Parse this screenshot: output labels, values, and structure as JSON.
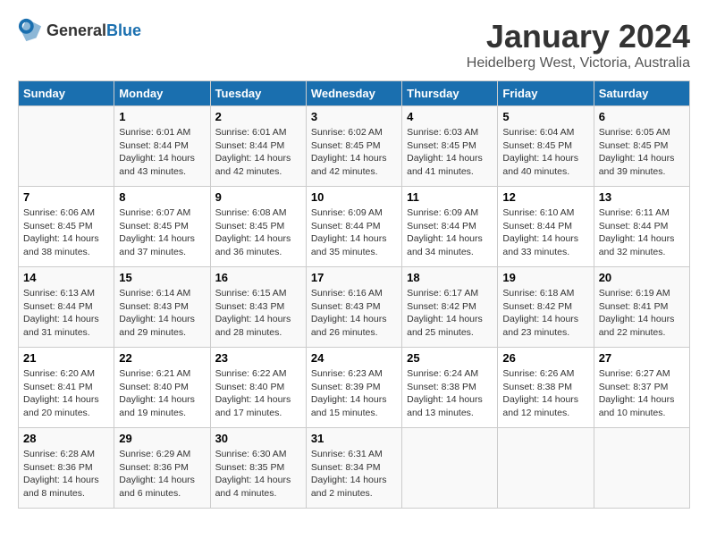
{
  "header": {
    "logo_general": "General",
    "logo_blue": "Blue",
    "month": "January 2024",
    "location": "Heidelberg West, Victoria, Australia"
  },
  "days_of_week": [
    "Sunday",
    "Monday",
    "Tuesday",
    "Wednesday",
    "Thursday",
    "Friday",
    "Saturday"
  ],
  "weeks": [
    [
      {
        "day": "",
        "empty": true
      },
      {
        "day": "1",
        "sunrise": "Sunrise: 6:01 AM",
        "sunset": "Sunset: 8:44 PM",
        "daylight": "Daylight: 14 hours and 43 minutes."
      },
      {
        "day": "2",
        "sunrise": "Sunrise: 6:01 AM",
        "sunset": "Sunset: 8:44 PM",
        "daylight": "Daylight: 14 hours and 42 minutes."
      },
      {
        "day": "3",
        "sunrise": "Sunrise: 6:02 AM",
        "sunset": "Sunset: 8:45 PM",
        "daylight": "Daylight: 14 hours and 42 minutes."
      },
      {
        "day": "4",
        "sunrise": "Sunrise: 6:03 AM",
        "sunset": "Sunset: 8:45 PM",
        "daylight": "Daylight: 14 hours and 41 minutes."
      },
      {
        "day": "5",
        "sunrise": "Sunrise: 6:04 AM",
        "sunset": "Sunset: 8:45 PM",
        "daylight": "Daylight: 14 hours and 40 minutes."
      },
      {
        "day": "6",
        "sunrise": "Sunrise: 6:05 AM",
        "sunset": "Sunset: 8:45 PM",
        "daylight": "Daylight: 14 hours and 39 minutes."
      }
    ],
    [
      {
        "day": "7",
        "sunrise": "Sunrise: 6:06 AM",
        "sunset": "Sunset: 8:45 PM",
        "daylight": "Daylight: 14 hours and 38 minutes."
      },
      {
        "day": "8",
        "sunrise": "Sunrise: 6:07 AM",
        "sunset": "Sunset: 8:45 PM",
        "daylight": "Daylight: 14 hours and 37 minutes."
      },
      {
        "day": "9",
        "sunrise": "Sunrise: 6:08 AM",
        "sunset": "Sunset: 8:45 PM",
        "daylight": "Daylight: 14 hours and 36 minutes."
      },
      {
        "day": "10",
        "sunrise": "Sunrise: 6:09 AM",
        "sunset": "Sunset: 8:44 PM",
        "daylight": "Daylight: 14 hours and 35 minutes."
      },
      {
        "day": "11",
        "sunrise": "Sunrise: 6:09 AM",
        "sunset": "Sunset: 8:44 PM",
        "daylight": "Daylight: 14 hours and 34 minutes."
      },
      {
        "day": "12",
        "sunrise": "Sunrise: 6:10 AM",
        "sunset": "Sunset: 8:44 PM",
        "daylight": "Daylight: 14 hours and 33 minutes."
      },
      {
        "day": "13",
        "sunrise": "Sunrise: 6:11 AM",
        "sunset": "Sunset: 8:44 PM",
        "daylight": "Daylight: 14 hours and 32 minutes."
      }
    ],
    [
      {
        "day": "14",
        "sunrise": "Sunrise: 6:13 AM",
        "sunset": "Sunset: 8:44 PM",
        "daylight": "Daylight: 14 hours and 31 minutes."
      },
      {
        "day": "15",
        "sunrise": "Sunrise: 6:14 AM",
        "sunset": "Sunset: 8:43 PM",
        "daylight": "Daylight: 14 hours and 29 minutes."
      },
      {
        "day": "16",
        "sunrise": "Sunrise: 6:15 AM",
        "sunset": "Sunset: 8:43 PM",
        "daylight": "Daylight: 14 hours and 28 minutes."
      },
      {
        "day": "17",
        "sunrise": "Sunrise: 6:16 AM",
        "sunset": "Sunset: 8:43 PM",
        "daylight": "Daylight: 14 hours and 26 minutes."
      },
      {
        "day": "18",
        "sunrise": "Sunrise: 6:17 AM",
        "sunset": "Sunset: 8:42 PM",
        "daylight": "Daylight: 14 hours and 25 minutes."
      },
      {
        "day": "19",
        "sunrise": "Sunrise: 6:18 AM",
        "sunset": "Sunset: 8:42 PM",
        "daylight": "Daylight: 14 hours and 23 minutes."
      },
      {
        "day": "20",
        "sunrise": "Sunrise: 6:19 AM",
        "sunset": "Sunset: 8:41 PM",
        "daylight": "Daylight: 14 hours and 22 minutes."
      }
    ],
    [
      {
        "day": "21",
        "sunrise": "Sunrise: 6:20 AM",
        "sunset": "Sunset: 8:41 PM",
        "daylight": "Daylight: 14 hours and 20 minutes."
      },
      {
        "day": "22",
        "sunrise": "Sunrise: 6:21 AM",
        "sunset": "Sunset: 8:40 PM",
        "daylight": "Daylight: 14 hours and 19 minutes."
      },
      {
        "day": "23",
        "sunrise": "Sunrise: 6:22 AM",
        "sunset": "Sunset: 8:40 PM",
        "daylight": "Daylight: 14 hours and 17 minutes."
      },
      {
        "day": "24",
        "sunrise": "Sunrise: 6:23 AM",
        "sunset": "Sunset: 8:39 PM",
        "daylight": "Daylight: 14 hours and 15 minutes."
      },
      {
        "day": "25",
        "sunrise": "Sunrise: 6:24 AM",
        "sunset": "Sunset: 8:38 PM",
        "daylight": "Daylight: 14 hours and 13 minutes."
      },
      {
        "day": "26",
        "sunrise": "Sunrise: 6:26 AM",
        "sunset": "Sunset: 8:38 PM",
        "daylight": "Daylight: 14 hours and 12 minutes."
      },
      {
        "day": "27",
        "sunrise": "Sunrise: 6:27 AM",
        "sunset": "Sunset: 8:37 PM",
        "daylight": "Daylight: 14 hours and 10 minutes."
      }
    ],
    [
      {
        "day": "28",
        "sunrise": "Sunrise: 6:28 AM",
        "sunset": "Sunset: 8:36 PM",
        "daylight": "Daylight: 14 hours and 8 minutes."
      },
      {
        "day": "29",
        "sunrise": "Sunrise: 6:29 AM",
        "sunset": "Sunset: 8:36 PM",
        "daylight": "Daylight: 14 hours and 6 minutes."
      },
      {
        "day": "30",
        "sunrise": "Sunrise: 6:30 AM",
        "sunset": "Sunset: 8:35 PM",
        "daylight": "Daylight: 14 hours and 4 minutes."
      },
      {
        "day": "31",
        "sunrise": "Sunrise: 6:31 AM",
        "sunset": "Sunset: 8:34 PM",
        "daylight": "Daylight: 14 hours and 2 minutes."
      },
      {
        "day": "",
        "empty": true
      },
      {
        "day": "",
        "empty": true
      },
      {
        "day": "",
        "empty": true
      }
    ]
  ]
}
